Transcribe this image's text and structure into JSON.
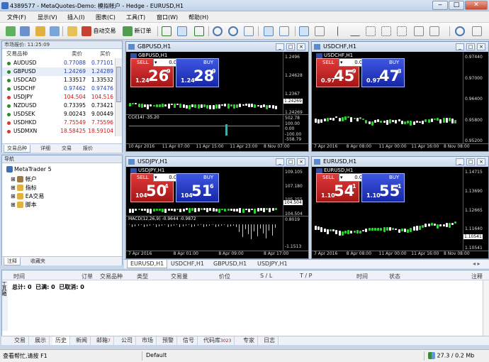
{
  "window": {
    "title": "4389577 - MetaQuotes-Demo: 模拟帐户 - Hedge - EURUSD,H1",
    "minimize": "‒",
    "maximize": "□",
    "close": "✕"
  },
  "menu": [
    "文件(F)",
    "显示(V)",
    "插入(I)",
    "图表(C)",
    "工具(T)",
    "窗口(W)",
    "帮助(H)"
  ],
  "toolbar": {
    "auto_trading": "自动交易",
    "new_order": "新订单"
  },
  "market_watch": {
    "title": "市场报价: 11:25:09",
    "headers": {
      "symbol": "交易品种",
      "bid": "卖价",
      "ask": "买价"
    },
    "rows": [
      {
        "symbol": "AUDUSD",
        "bid": "0.77088",
        "ask": "0.77101",
        "color": "#1f3fbf"
      },
      {
        "symbol": "GBPUSD",
        "bid": "1.24269",
        "ask": "1.24289",
        "color": "#1f3fbf"
      },
      {
        "symbol": "USDCAD",
        "bid": "1.33517",
        "ask": "1.33532",
        "color": "#000000"
      },
      {
        "symbol": "USDCHF",
        "bid": "0.97462",
        "ask": "0.97476",
        "color": "#1f3fbf"
      },
      {
        "symbol": "USDJPY",
        "bid": "104.504",
        "ask": "104.516",
        "color": "#d01818"
      },
      {
        "symbol": "NZDUSD",
        "bid": "0.73395",
        "ask": "0.73421",
        "color": "#000000"
      },
      {
        "symbol": "USDSEK",
        "bid": "9.00243",
        "ask": "9.00449",
        "color": "#000000"
      },
      {
        "symbol": "USDHKD",
        "bid": "7.75549",
        "ask": "7.75596",
        "color": "#d01818"
      },
      {
        "symbol": "USDMXN",
        "bid": "18.58425",
        "ask": "18.59104",
        "color": "#d01818"
      }
    ],
    "tabs": [
      "交易品种",
      "详细",
      "交易",
      "报价"
    ]
  },
  "navigator": {
    "title": "导航",
    "root": "MetaTrader 5",
    "items": [
      "帐户",
      "指标",
      "EA交易",
      "脚本"
    ],
    "tabs": [
      "注释",
      "收藏夹"
    ]
  },
  "charts": [
    {
      "title": "GBPUSD,H1",
      "label": "GBPUSD,H1",
      "lot": "0.01",
      "sell": "SELL",
      "buy": "BUY",
      "sell_pre": "1.24",
      "sell_big": "26",
      "sell_pip": "9",
      "buy_pre": "1.24",
      "buy_big": "28",
      "buy_pip": "9",
      "y_ticks": [
        "1.2496",
        "1.24628",
        "1.2367",
        "1.24269"
      ],
      "price_tag": "1.24269",
      "indicator": "CCI(14) -35.20",
      "ind_ticks": [
        "502.78",
        "100.00",
        "0.00",
        "-100.00",
        "-558.79"
      ],
      "x_ticks": [
        "10 Apr 2016",
        "11 Apr 07:00",
        "11 Apr 15:00",
        "11 Apr 23:00",
        "8 Nov 07:00"
      ]
    },
    {
      "title": "USDCHF,H1",
      "label": "USDCHF,H1",
      "lot": "0.01",
      "sell": "SELL",
      "buy": "BUY",
      "sell_pre": "0.97",
      "sell_big": "45",
      "sell_pip": "9",
      "buy_pre": "0.97",
      "buy_big": "47",
      "buy_pip": "3",
      "y_ticks": [
        "0.97440",
        "0.97000",
        "0.96400",
        "0.95800",
        "0.95200"
      ],
      "price_tag": "",
      "x_ticks": [
        "7 Apr 2016",
        "8 Apr 08:00",
        "11 Apr 00:00",
        "11 Apr 16:00",
        "8 Nov 08:00"
      ]
    },
    {
      "title": "USDJPY,H1",
      "label": "USDJPY,H1",
      "lot": "0.01",
      "sell": "SELL",
      "buy": "BUY",
      "sell_pre": "104",
      "sell_big": "50",
      "sell_pip": "4",
      "buy_pre": "104",
      "buy_big": "51",
      "buy_pip": "6",
      "y_ticks": [
        "109.105",
        "107.180",
        "105.255",
        "104.504"
      ],
      "price_tag": "104.504",
      "indicator": "MACD(12,26,9) -0.9644 -0.9872",
      "ind_ticks": [
        "0.8019",
        "-1.1513"
      ],
      "x_ticks": [
        "7 Apr 2016",
        "8 Apr 01:00",
        "8 Apr 09:00",
        "8 Apr 17:00"
      ]
    },
    {
      "title": "EURUSD,H1",
      "label": "EURUSD,H1",
      "lot": "0.01",
      "sell": "SELL",
      "buy": "BUY",
      "sell_pre": "1.10",
      "sell_big": "54",
      "sell_pip": "1",
      "buy_pre": "1.10",
      "buy_big": "55",
      "buy_pip": "1",
      "y_ticks": [
        "1.14715",
        "1.13690",
        "1.12665",
        "1.11640",
        "1.10541"
      ],
      "price_tag": "1.10541",
      "x_ticks": [
        "7 Apr 2016",
        "8 Apr 08:00",
        "11 Apr 00:00",
        "11 Apr 16:00",
        "8 Nov 08:00"
      ]
    }
  ],
  "chart_tabs": [
    "EURUSD,H1",
    "USDCHF,H1",
    "GBPUSD,H1",
    "USDJPY,H1"
  ],
  "toolbox": {
    "columns": [
      "时间",
      "订单",
      "交易品种",
      "类型",
      "交易量",
      "价位",
      "S / L",
      "T / P",
      "时间",
      "状态",
      "注释"
    ],
    "summary": "总计: 0  已满: 0  已取消: 0",
    "side_label": "工具箱",
    "tabs": [
      {
        "label": "交易",
        "badge": ""
      },
      {
        "label": "展示",
        "badge": ""
      },
      {
        "label": "历史",
        "badge": ""
      },
      {
        "label": "新闻",
        "badge": ""
      },
      {
        "label": "邮箱",
        "badge": "7"
      },
      {
        "label": "公司",
        "badge": ""
      },
      {
        "label": "市场",
        "badge": ""
      },
      {
        "label": "预警",
        "badge": ""
      },
      {
        "label": "信号",
        "badge": ""
      },
      {
        "label": "代码库",
        "badge": "3023"
      },
      {
        "label": "专家",
        "badge": ""
      },
      {
        "label": "日志",
        "badge": ""
      }
    ]
  },
  "status": {
    "help": "查看帮忙,请按 F1",
    "profile": "Default",
    "traffic": "27.3 / 0.2 Mb"
  }
}
